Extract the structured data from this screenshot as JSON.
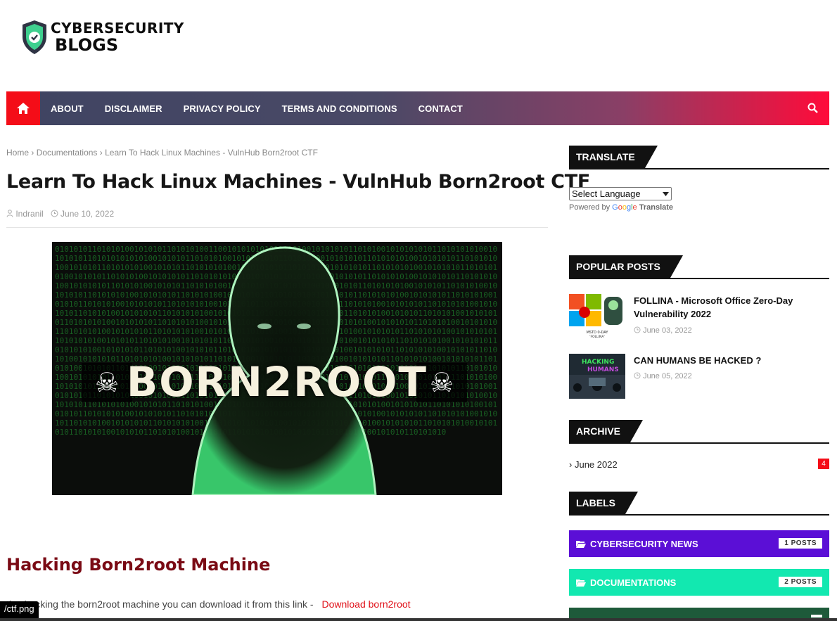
{
  "logo": {
    "line1": "CYBERSECURITY",
    "line2": "BLOGS"
  },
  "nav": {
    "items": [
      "ABOUT",
      "DISCLAIMER",
      "PRIVACY POLICY",
      "TERMS AND CONDITIONS",
      "CONTACT"
    ],
    "home_icon": "home-icon",
    "search_icon": "search-icon",
    "accent": "#f40d18"
  },
  "breadcrumb": {
    "home": "Home",
    "section": "Documentations",
    "current": "Learn To Hack Linux Machines - VulnHub Born2root CTF"
  },
  "post": {
    "title": "Learn To Hack Linux Machines - VulnHub Born2root CTF",
    "author": "Indranil",
    "date": "June 10, 2022",
    "hero_text": "BORN2ROOT",
    "subheading": "Hacking  Born2root Machine",
    "paragraph": "tice hacking the born2root machine you can download it from this link  -",
    "link_text": "Download born2root"
  },
  "status_tooltip": "/ctf.png",
  "sidebar": {
    "translate": {
      "heading": "TRANSLATE",
      "select_value": "Select Language",
      "powered_by": "Powered by",
      "google": "Google",
      "translate_word": "Translate"
    },
    "popular": {
      "heading": "POPULAR POSTS",
      "posts": [
        {
          "title": "FOLLINA - Microsoft Office Zero-Day Vulnerability 2022",
          "date": "June 03, 2022",
          "thumb_caption": "MSTD 0-DAY 'FOLLINA'"
        },
        {
          "title": "CAN HUMANS BE HACKED ?",
          "date": "June 05, 2022",
          "thumb_caption": "HACKING HUMANS"
        }
      ]
    },
    "archive": {
      "heading": "ARCHIVE",
      "item": "June 2022",
      "count": "4"
    },
    "labels": {
      "heading": "LABELS",
      "items": [
        {
          "name": "CYBERSECURITY NEWS",
          "count": "1 POSTS",
          "color": "#5b0fd6"
        },
        {
          "name": "DOCUMENTATIONS",
          "count": "2 POSTS",
          "color": "#12e8b0"
        },
        {
          "name": "",
          "count": "",
          "color": "#1e5a3a"
        }
      ]
    }
  }
}
